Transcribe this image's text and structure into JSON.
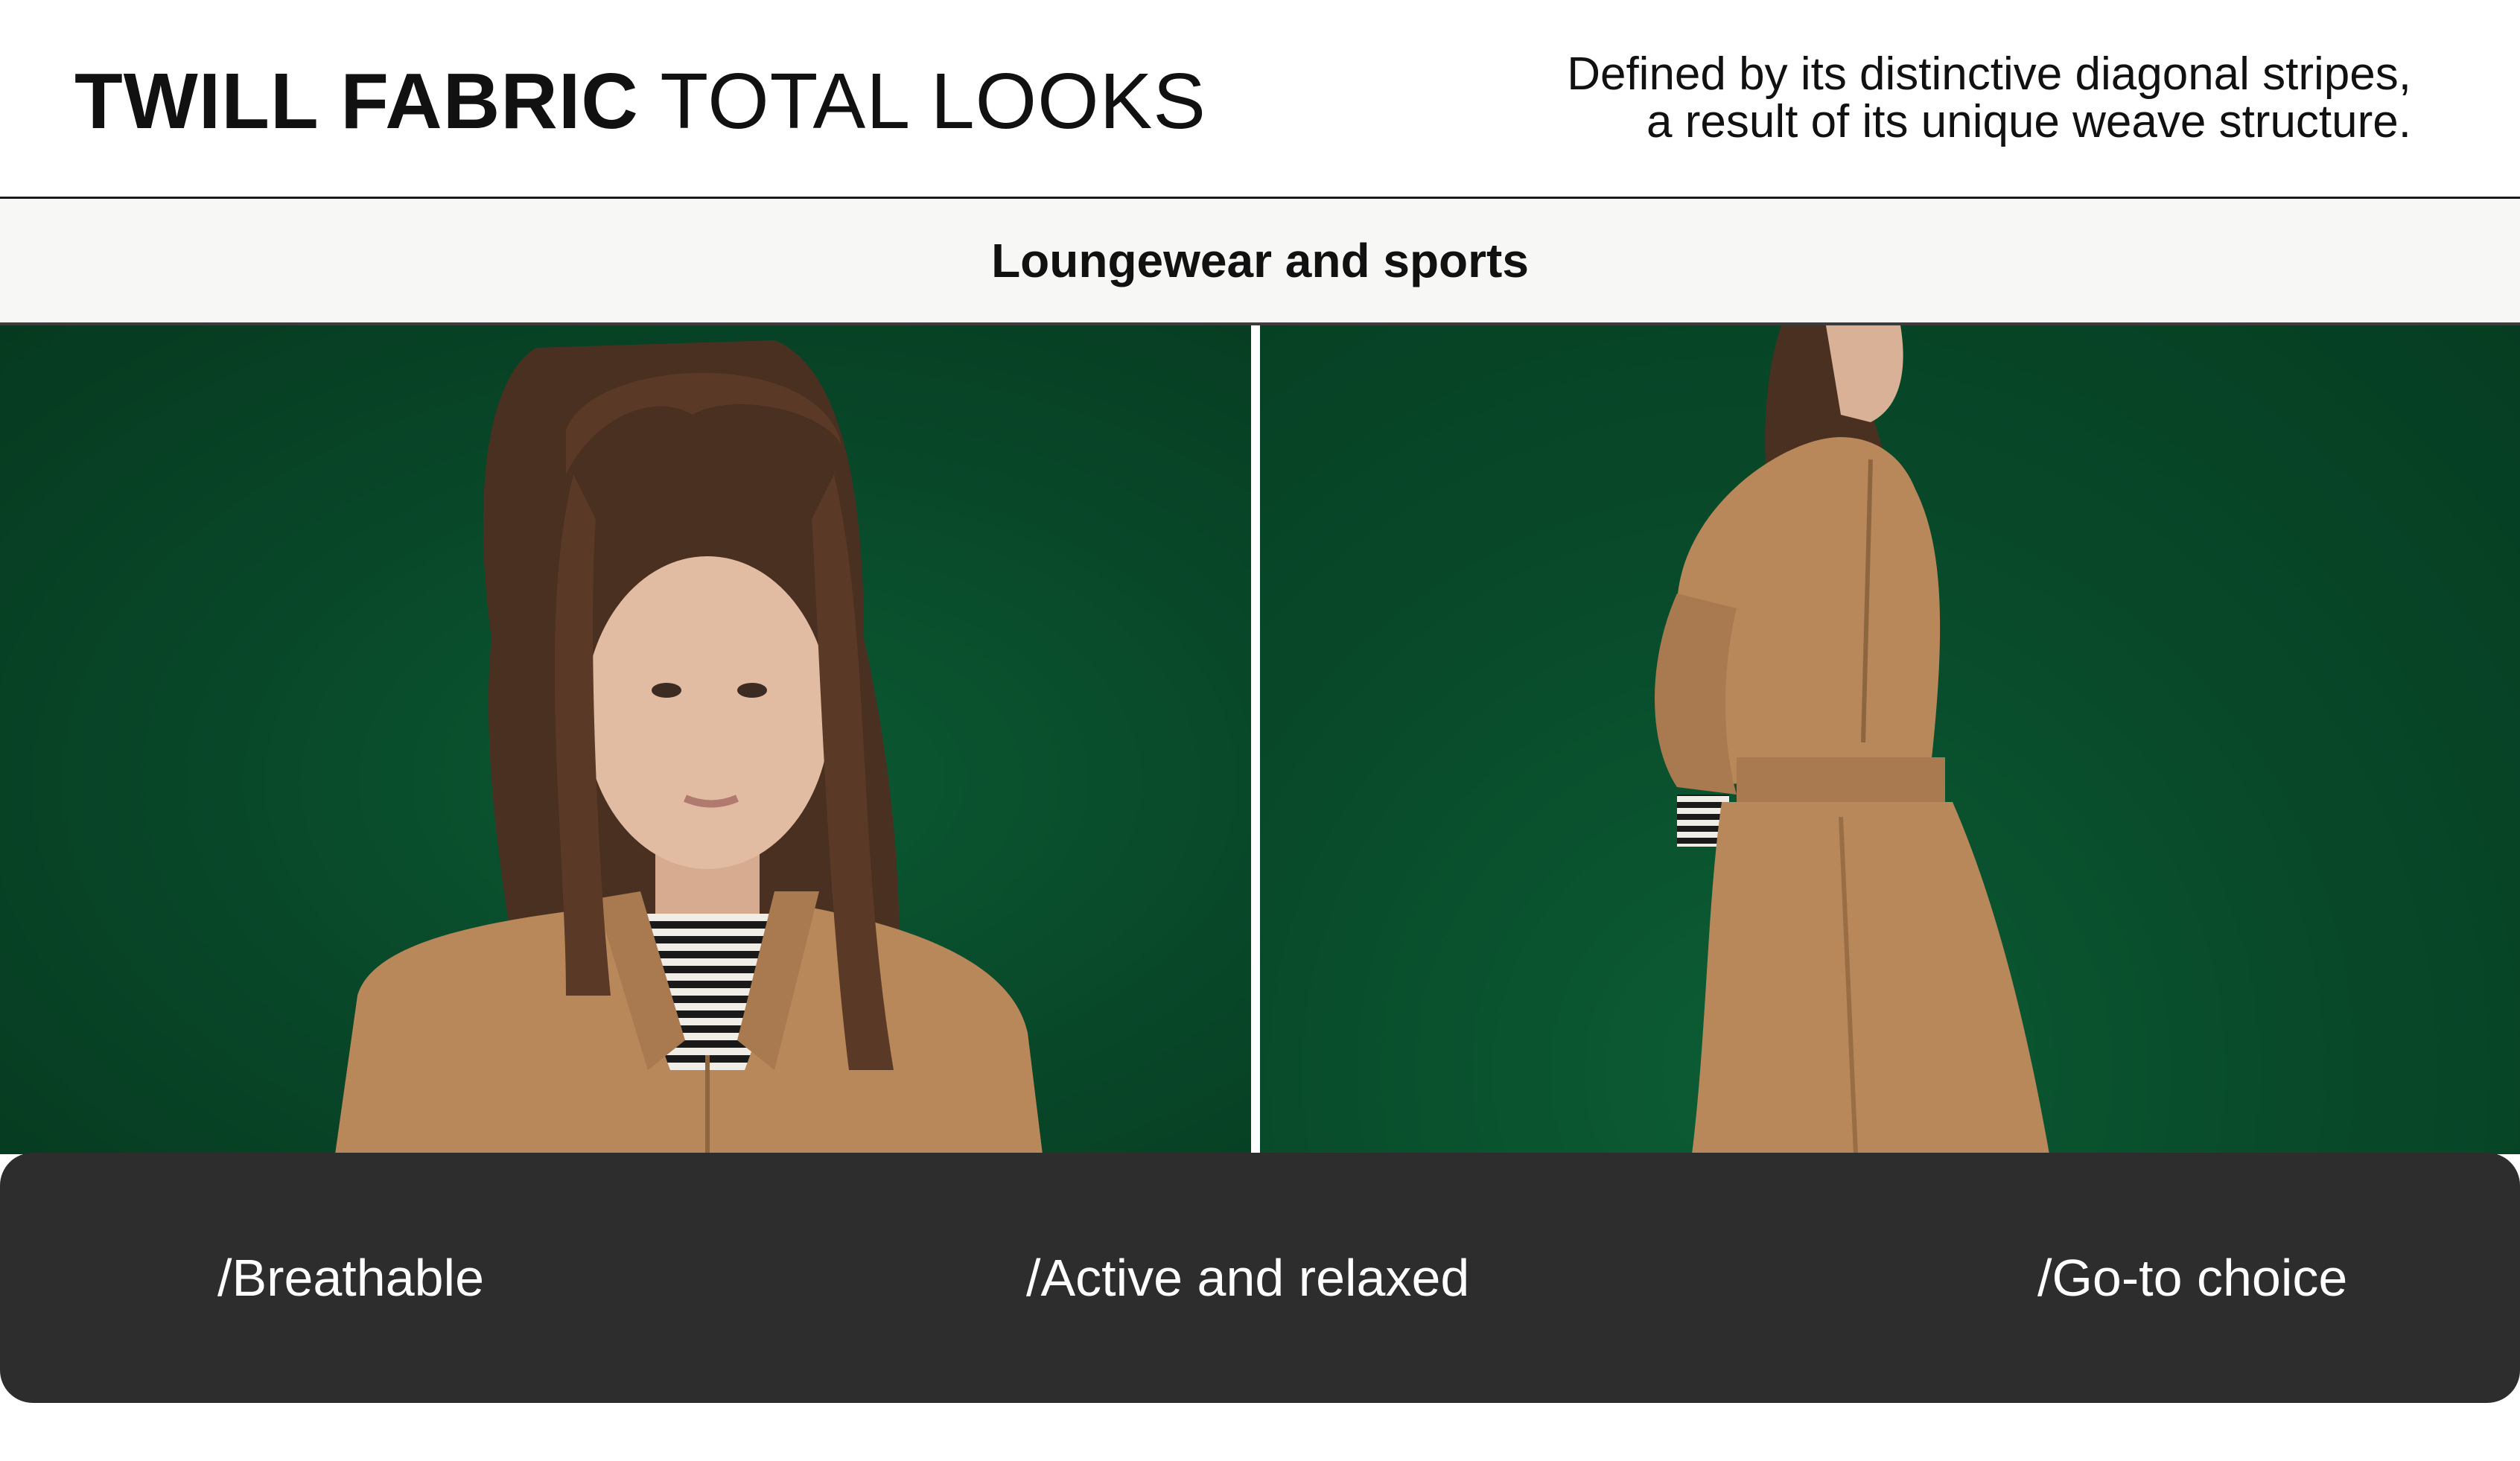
{
  "header": {
    "title_bold": "TWILL FABRIC",
    "title_light": "TOTAL LOOKS",
    "subtitle_line1": "Defined by its distinctive diagonal stripes,",
    "subtitle_line2": "a result of its unique weave structure."
  },
  "category": {
    "label": "Loungewear and sports"
  },
  "photos": [
    {
      "icon": "model-portrait-photo",
      "background": "#084628",
      "garment": "#b8875a"
    },
    {
      "icon": "model-full-look-photo",
      "background": "#084a2a",
      "garment": "#b8875a"
    }
  ],
  "features": [
    {
      "label": "/Breathable"
    },
    {
      "label": "/Active and relaxed"
    },
    {
      "label": "/Go-to choice"
    }
  ],
  "colors": {
    "feature_bar": "#2d2d2d",
    "band": "#f7f7f5",
    "green": "#084628",
    "camel": "#b8875a"
  }
}
